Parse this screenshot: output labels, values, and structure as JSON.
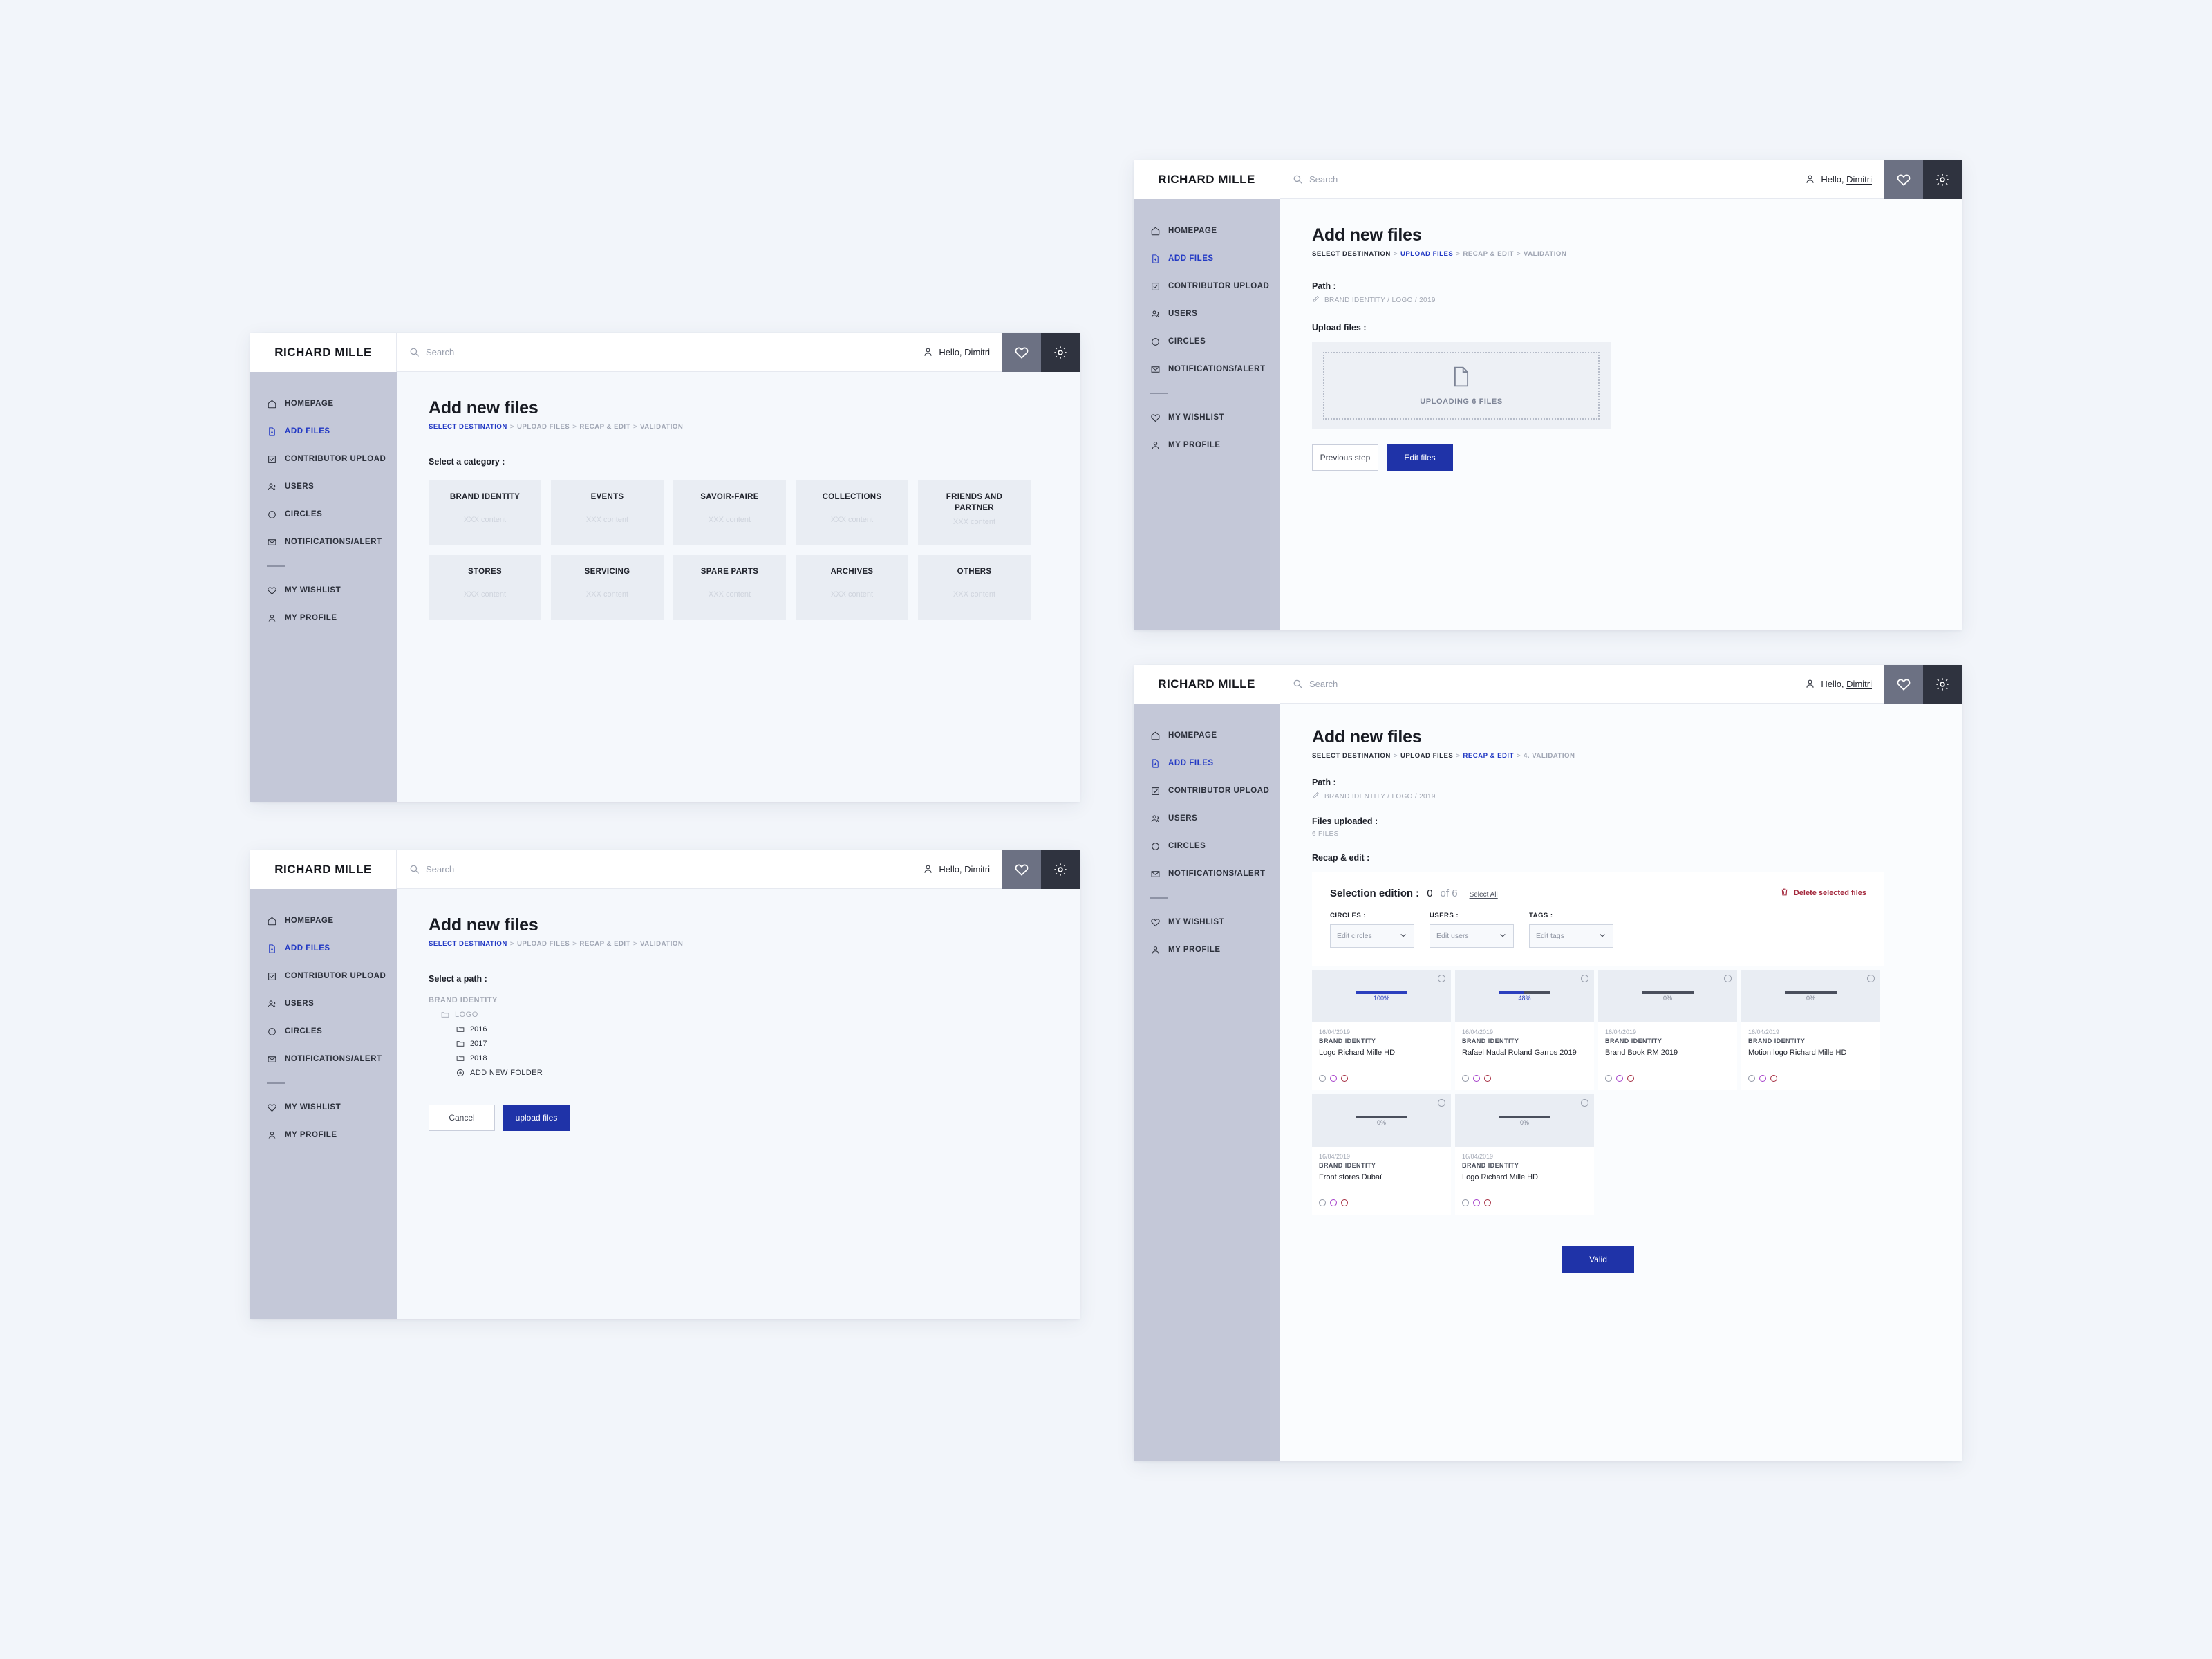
{
  "brand": "RICHARD MILLE",
  "header": {
    "search_placeholder": "Search",
    "search_value": "",
    "greeting_prefix": "Hello, ",
    "user_name": "Dimitri",
    "heart_icon": "heart-icon",
    "gear_icon": "gear-icon",
    "search_icon": "search-icon",
    "user_icon": "user-icon"
  },
  "sidebar": {
    "items": [
      {
        "label": "HOMEPAGE",
        "icon": "home-icon",
        "active": false
      },
      {
        "label": "ADD FILES",
        "icon": "file-add-icon",
        "active": true
      },
      {
        "label": "CONTRIBUTOR UPLOAD",
        "icon": "checklist-icon",
        "active": false
      },
      {
        "label": "USERS",
        "icon": "users-icon",
        "active": false
      },
      {
        "label": "CIRCLES",
        "icon": "circle-icon",
        "active": false
      },
      {
        "label": "NOTIFICATIONS/ALERT",
        "icon": "mail-icon",
        "active": false
      }
    ],
    "items_secondary": [
      {
        "label": "MY WISHLIST",
        "icon": "heart-outline-icon",
        "active": false
      },
      {
        "label": "MY PROFILE",
        "icon": "profile-icon",
        "active": false
      }
    ]
  },
  "colors": {
    "accent_blue": "#2239c4",
    "primary_button": "#1f33a8",
    "sidebar_bg": "#c4c8d8",
    "page_bg": "#f2f5fa",
    "main_bg": "#f5f8fc",
    "danger_red": "#a3283c",
    "dot_purple": "#a33bc9",
    "gear_btn": "#2f333f",
    "heart_btn": "#6c7183"
  },
  "panel1": {
    "title": "Add new files",
    "breadcrumbs": [
      {
        "label": "SELECT DESTINATION",
        "state": "active"
      },
      {
        "label": "UPLOAD FILES",
        "state": "muted"
      },
      {
        "label": "RECAP & EDIT",
        "state": "muted"
      },
      {
        "label": "VALIDATION",
        "state": "muted"
      }
    ],
    "section_label": "Select a category :",
    "categories": [
      {
        "name": "BRAND IDENTITY",
        "sub": "XXX content"
      },
      {
        "name": "EVENTS",
        "sub": "XXX content"
      },
      {
        "name": "SAVOIR-FAIRE",
        "sub": "XXX content"
      },
      {
        "name": "COLLECTIONS",
        "sub": "XXX content"
      },
      {
        "name": "FRIENDS AND PARTNER",
        "sub": "XXX content"
      },
      {
        "name": "STORES",
        "sub": "XXX content"
      },
      {
        "name": "SERVICING",
        "sub": "XXX content"
      },
      {
        "name": "SPARE PARTS",
        "sub": "XXX content"
      },
      {
        "name": "ARCHIVES",
        "sub": "XXX content"
      },
      {
        "name": "OTHERS",
        "sub": "XXX content"
      }
    ]
  },
  "panel2": {
    "title": "Add new files",
    "breadcrumbs": [
      {
        "label": "SELECT DESTINATION",
        "state": "active"
      },
      {
        "label": "UPLOAD FILES",
        "state": "muted"
      },
      {
        "label": "RECAP & EDIT",
        "state": "muted"
      },
      {
        "label": "VALIDATION",
        "state": "muted"
      }
    ],
    "section_label": "Select a path :",
    "tree_root": "BRAND IDENTITY",
    "tree_level1": "LOGO",
    "tree_children": [
      "2016",
      "2017",
      "2018"
    ],
    "add_folder": "ADD NEW FOLDER",
    "cancel_label": "Cancel",
    "upload_label": "upload files"
  },
  "panel3": {
    "title": "Add new files",
    "breadcrumbs": [
      {
        "label": "SELECT DESTINATION",
        "state": "done"
      },
      {
        "label": "UPLOAD FILES",
        "state": "active"
      },
      {
        "label": "RECAP & EDIT",
        "state": "muted"
      },
      {
        "label": "VALIDATION",
        "state": "muted"
      }
    ],
    "path_label": "Path :",
    "path_value": "BRAND IDENTITY / LOGO / 2019",
    "upload_label": "Upload files :",
    "upload_status": "UPLOADING 6 FILES",
    "upload_icon": "document-icon",
    "previous_label": "Previous step",
    "edit_label": "Edit files"
  },
  "panel4": {
    "title": "Add new files",
    "breadcrumbs": [
      {
        "label": "SELECT DESTINATION",
        "state": "done"
      },
      {
        "label": "UPLOAD FILES",
        "state": "done"
      },
      {
        "label": "RECAP & EDIT",
        "state": "active"
      },
      {
        "label": "4. VALIDATION",
        "state": "muted"
      }
    ],
    "path_label": "Path :",
    "path_value": "BRAND IDENTITY / LOGO / 2019",
    "files_label": "Files uploaded :",
    "files_value": "6 FILES",
    "recap_label": "Recap & edit :",
    "selection_title": "Selection edition :",
    "selected_count": "0",
    "total_count": "of 6",
    "select_all": "Select All",
    "delete_label": "Delete selected files",
    "delete_icon": "trash-icon",
    "fields": [
      {
        "label": "CIRCLES :",
        "placeholder": "Edit circles"
      },
      {
        "label": "USERS :",
        "placeholder": "Edit users"
      },
      {
        "label": "TAGS :",
        "placeholder": "Edit tags"
      }
    ],
    "cards": [
      {
        "date": "16/04/2019",
        "category": "BRAND IDENTITY",
        "name": "Logo Richard Mille HD",
        "progress": "100%",
        "pct": 100
      },
      {
        "date": "16/04/2019",
        "category": "BRAND IDENTITY",
        "name": "Rafael Nadal Roland Garros 2019",
        "progress": "48%",
        "pct": 48
      },
      {
        "date": "16/04/2019",
        "category": "BRAND IDENTITY",
        "name": "Brand Book RM 2019",
        "progress": "0%",
        "pct": 0
      },
      {
        "date": "16/04/2019",
        "category": "BRAND IDENTITY",
        "name": "Motion logo Richard Mille HD",
        "progress": "0%",
        "pct": 0
      },
      {
        "date": "16/04/2019",
        "category": "BRAND IDENTITY",
        "name": "Front stores Dubaï",
        "progress": "0%",
        "pct": 0
      },
      {
        "date": "16/04/2019",
        "category": "BRAND IDENTITY",
        "name": "Logo Richard Mille HD",
        "progress": "0%",
        "pct": 0
      }
    ],
    "valid_label": "Valid"
  }
}
